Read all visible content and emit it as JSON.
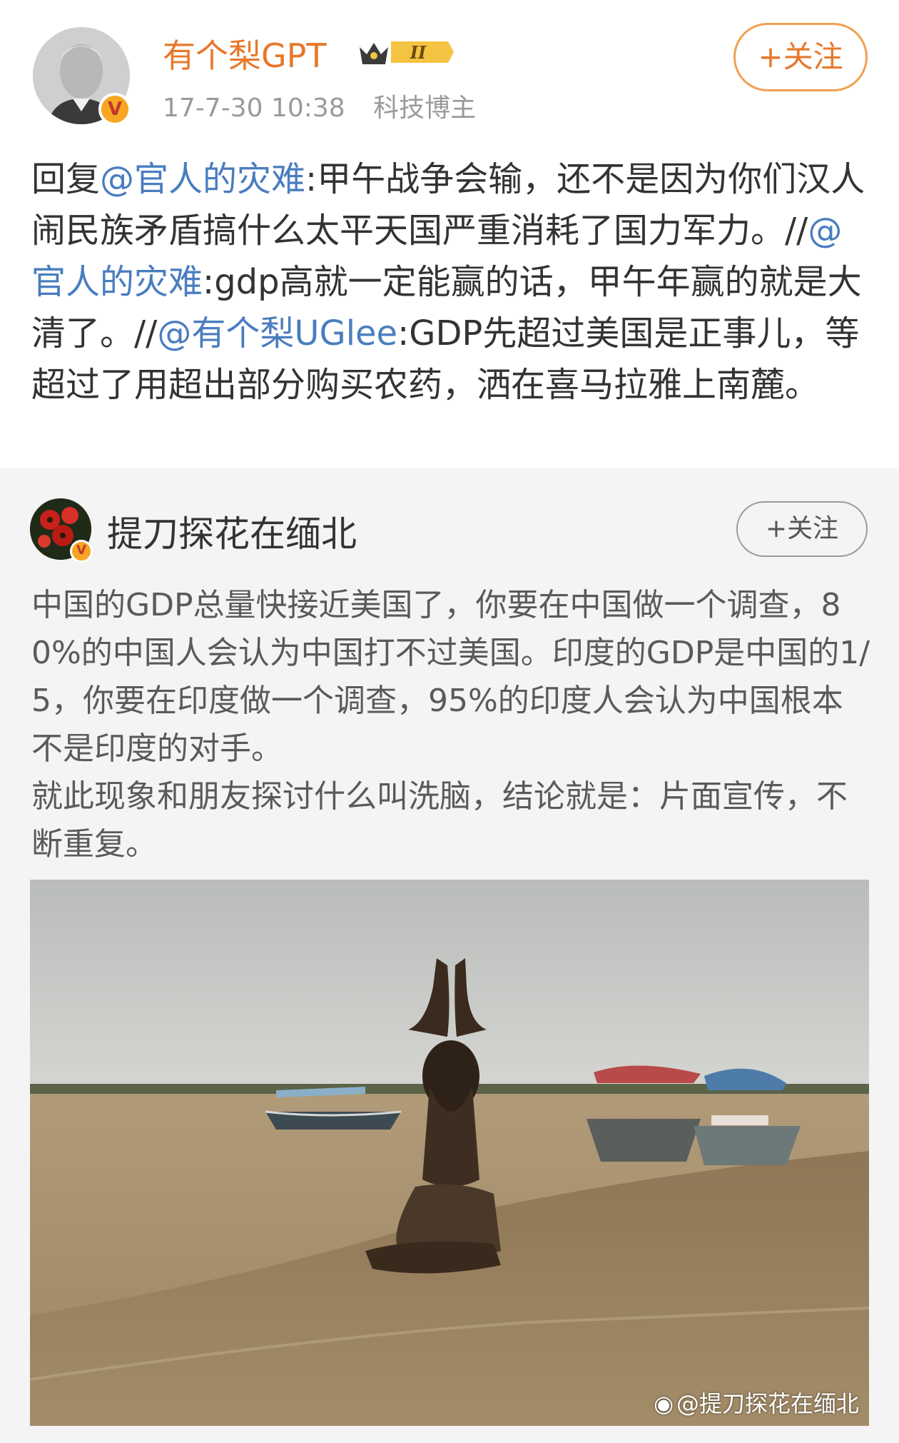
{
  "post": {
    "username": "有个梨GPT",
    "level_badge": "II",
    "time": "17-7-30 10:38",
    "tag": "科技博主",
    "follow_label": "+关注",
    "verified_mark": "V",
    "text_parts": [
      {
        "t": "回复",
        "mention": false
      },
      {
        "t": "@官人的灾难",
        "mention": true
      },
      {
        "t": ":甲午战争会输，还不是因为你们汉人闹民族矛盾搞什么太平天国严重消耗了国力军力。//",
        "mention": false
      },
      {
        "t": "@官人的灾难",
        "mention": true
      },
      {
        "t": ":gdp高就一定能赢的话，甲午年赢的就是大清了。//",
        "mention": false
      },
      {
        "t": "@有个梨UGlee",
        "mention": true
      },
      {
        "t": ":GDP先超过美国是正事儿，等超过了用超出部分购买农药，洒在喜马拉雅上南麓。",
        "mention": false
      }
    ]
  },
  "repost": {
    "username": "提刀探花在缅北",
    "follow_label": "+关注",
    "verified_mark": "V",
    "text_line1": "中国的GDP总量快接近美国了，你要在中国做一个调查，80%的中国人会认为中国打不过美国。印度的GDP是中国的1/5，你要在印度做一个调查，95%的印度人会认为中国根本不是印度的对手。",
    "text_line2": "就此现象和朋友探讨什么叫洗脑，结论就是：片面宣传，不断重复。",
    "watermark": "@提刀探花在缅北"
  },
  "colors": {
    "accent_orange": "#e8782a",
    "mention_blue": "#4a7dc0",
    "repost_bg": "#f4f4f4"
  }
}
